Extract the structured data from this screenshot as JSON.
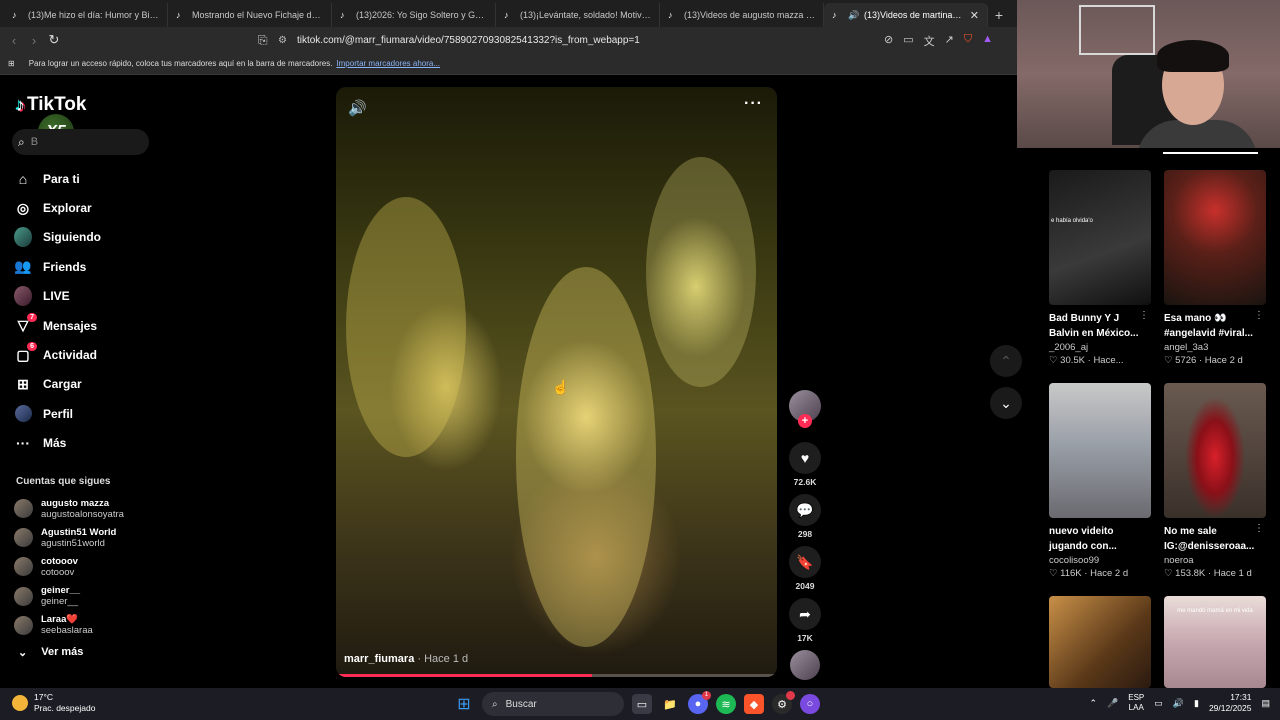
{
  "browser": {
    "tabs": [
      {
        "label": "(13)Me hizo el día: Humor y Bicicleta"
      },
      {
        "label": "Mostrando el Nuevo Fichaje de West"
      },
      {
        "label": "(13)2026: Yo Sigo Soltero y Gozando"
      },
      {
        "label": "(13)¡Levántate, soldado! Motivación"
      },
      {
        "label": "(13)Videos de augusto mazza (@aug"
      },
      {
        "label": "(13)Videos de martina fiumar",
        "active": true
      }
    ],
    "url": "tiktok.com/@marr_fiumara/video/7589027093082541332?is_from_webapp=1",
    "bookmarks_text": "Para lograr un acceso rápido, coloca tus marcadores aquí en la barra de marcadores.",
    "bookmarks_link": "Importar marcadores ahora..."
  },
  "sidebar": {
    "logo": "TikTok",
    "badge": "X5",
    "search_placeholder": "B",
    "nav": [
      {
        "label": "Para ti",
        "icon": "home-icon"
      },
      {
        "label": "Explorar",
        "icon": "compass-icon"
      },
      {
        "label": "Siguiendo",
        "icon": "following-icon"
      },
      {
        "label": "Friends",
        "icon": "friends-icon"
      },
      {
        "label": "LIVE",
        "icon": "live-icon"
      },
      {
        "label": "Mensajes",
        "icon": "messages-icon",
        "badge": "7"
      },
      {
        "label": "Actividad",
        "icon": "activity-icon",
        "badge": "6"
      },
      {
        "label": "Cargar",
        "icon": "upload-icon"
      },
      {
        "label": "Perfil",
        "icon": "profile-icon"
      },
      {
        "label": "Más",
        "icon": "more-icon"
      }
    ],
    "following_title": "Cuentas que sigues",
    "following": [
      {
        "name": "augusto mazza",
        "user": "augustoalonsoyatra"
      },
      {
        "name": "Agustin51 World",
        "user": "agustin51world"
      },
      {
        "name": "cotooov",
        "user": "cotooov"
      },
      {
        "name": "geiner__",
        "user": "geiner__"
      },
      {
        "name": "Laraa❤️",
        "user": "seebaslaraa"
      }
    ],
    "see_more": "Ver más"
  },
  "video": {
    "author": "marr_fiumara",
    "time": " · Hace 1 d",
    "progress": 0.58
  },
  "actions": {
    "likes": "72.6K",
    "comments": "298",
    "saves": "2049",
    "shares": "17K"
  },
  "recommended": [
    {
      "title1": "Bad Bunny Y J",
      "title2": "Balvin en México...",
      "user": "_2006_aj",
      "views": "♡ 30.5K",
      "time": "Hace...",
      "thumb_text": "e había olvida'o"
    },
    {
      "title1": "Esa mano 👀",
      "title2": "#angelavid #viral...",
      "user": "angel_3a3",
      "views": "♡ 5726",
      "time": "Hace 2 d",
      "thumb_text": ""
    },
    {
      "title1": "nuevo videito",
      "title2": "jugando con...",
      "user": "cocolisoo99",
      "views": "♡ 116K",
      "time": "Hace 2 d",
      "thumb_text": ""
    },
    {
      "title1": "No me sale",
      "title2": "IG:@denisseroaa...",
      "user": "noeroa",
      "views": "♡ 153.8K",
      "time": "Hace 1 d",
      "thumb_text": ""
    },
    {
      "title1": "",
      "title2": "",
      "user": "",
      "views": "",
      "time": "",
      "thumb_text": ""
    },
    {
      "title1": "",
      "title2": "",
      "user": "",
      "views": "",
      "time": "",
      "thumb_text": "me mandó mamá en mi vida"
    }
  ],
  "taskbar": {
    "temp": "17°C",
    "weather": "Prac. despejado",
    "search": "Buscar",
    "lang1": "ESP",
    "lang2": "LAA",
    "time": "17:31",
    "date": "29/12/2025"
  }
}
